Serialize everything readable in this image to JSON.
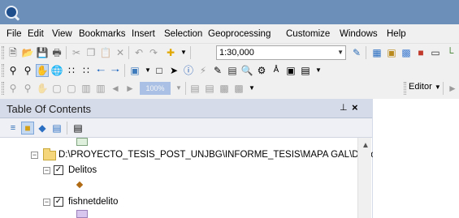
{
  "app": {
    "logo_icon": "arcmap-logo-icon"
  },
  "menu": [
    "File",
    "Edit",
    "View",
    "Bookmarks",
    "Insert",
    "Selection",
    "Geoprocessing",
    "Customize",
    "Windows",
    "Help"
  ],
  "toolbar": {
    "scale_value": "1:30,000",
    "zoom_percent": "100%",
    "editor_label": "Editor"
  },
  "toc": {
    "title": "Table Of Contents",
    "pin": "p",
    "close": "×",
    "data_frame_path": "D:\\PROYECTO_TESIS_POST_UNJBG\\INFORME_TESIS\\MAPA GAL\\Delitos",
    "layers": [
      {
        "name": "Delitos",
        "checked": true,
        "symbol_color": "#b06a13"
      },
      {
        "name": "fishnetdelito",
        "checked": true,
        "symbol_color": "#d9c6ef"
      }
    ],
    "top_swatch_color": "#dff0dc"
  },
  "colors": {
    "titlebar": "#6b8fb8",
    "toc_header": "#d6dbe9"
  }
}
